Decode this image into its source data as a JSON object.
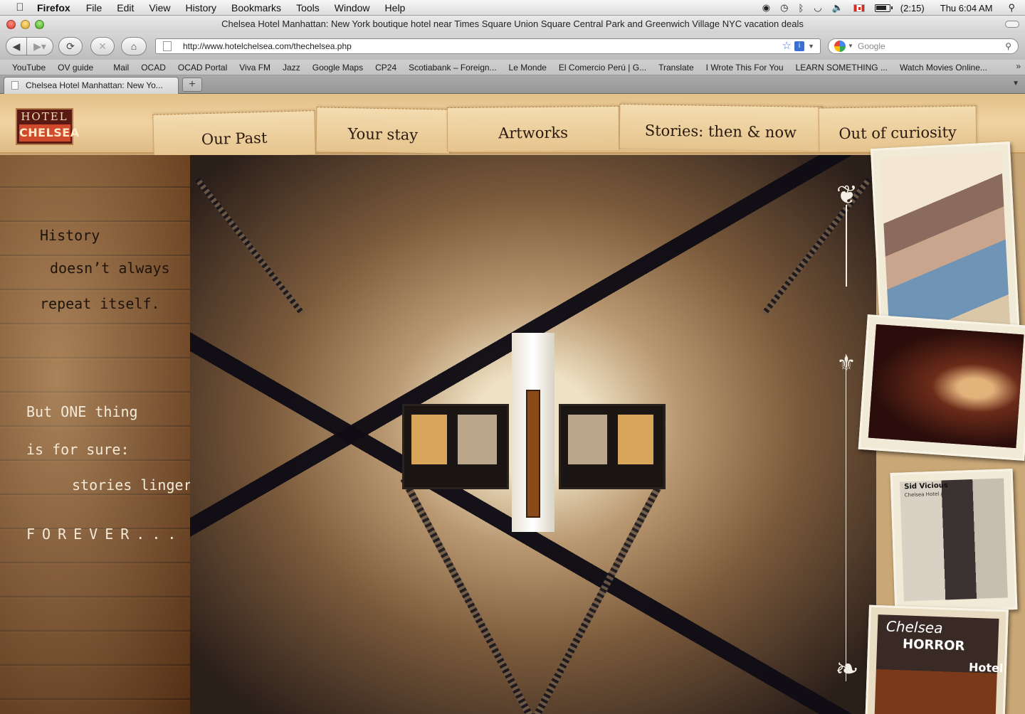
{
  "menubar": {
    "app": "Firefox",
    "items": [
      "File",
      "Edit",
      "View",
      "History",
      "Bookmarks",
      "Tools",
      "Window",
      "Help"
    ],
    "battery": "(2:15)",
    "clock": "Thu 6:04 AM"
  },
  "window": {
    "title": "Chelsea Hotel Manhattan: New York boutique hotel near Times Square Union Square Central Park and Greenwich Village NYC vacation deals"
  },
  "toolbar": {
    "url": "http://www.hotelchelsea.com/thechelsea.php",
    "search_placeholder": "Google"
  },
  "bookmarks": [
    "YouTube",
    "OV guide",
    "Mail",
    "OCAD",
    "OCAD Portal",
    "Viva FM",
    "Jazz",
    "Google Maps",
    "CP24",
    "Scotiabank – Foreign...",
    "Le Monde",
    "El Comercio Perú | G...",
    "Translate",
    "I Wrote This For You",
    "LEARN SOMETHING ...",
    "Watch Movies Online..."
  ],
  "tabs": [
    {
      "label": "Chelsea Hotel Manhattan: New Yo..."
    }
  ],
  "site": {
    "logo_top": "HOTEL",
    "logo_bottom": "CHELSEA",
    "nav": [
      "Our Past",
      "Your stay",
      "Artworks",
      "Stories: then & now",
      "Out of curiosity"
    ],
    "story": {
      "line1": "History",
      "line2": "doesn’t always",
      "line3": "repeat itself.",
      "line4": "But ONE thing",
      "line5": "is for sure:",
      "line6": "stories linger",
      "line7": "FOREVER..."
    },
    "photo_captions": {
      "sid": "Sid Vicious",
      "sid_sub": "Chelsea Hotel / NYC",
      "horror_1": "Chelsea",
      "horror_2": "HORROR",
      "horror_3": "Hotel"
    }
  }
}
